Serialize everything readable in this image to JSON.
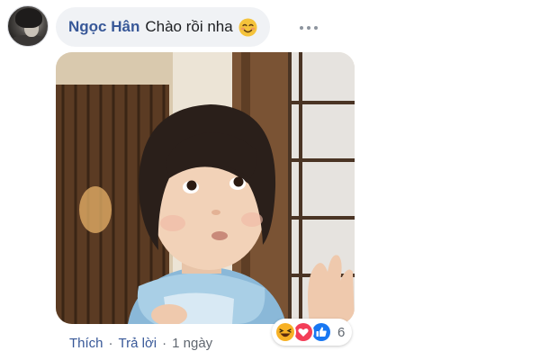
{
  "comment": {
    "author": "Ngọc Hân",
    "text": "Chào rồi nha",
    "emoji_icon": "smiling-blush-emoji"
  },
  "actions": {
    "like_label": "Thích",
    "separator": "·",
    "reply_label": "Trả lời",
    "timestamp": "1 ngày"
  },
  "reactions": {
    "icons": [
      "haha-reaction-icon",
      "love-reaction-icon",
      "like-reaction-icon"
    ],
    "count": "6"
  },
  "colors": {
    "author_link": "#385898",
    "bubble_bg": "#f0f2f5",
    "meta_text": "#606770",
    "like_blue": "#1877f2",
    "love_red": "#f33e58",
    "haha_yellow": "#f7b125"
  }
}
